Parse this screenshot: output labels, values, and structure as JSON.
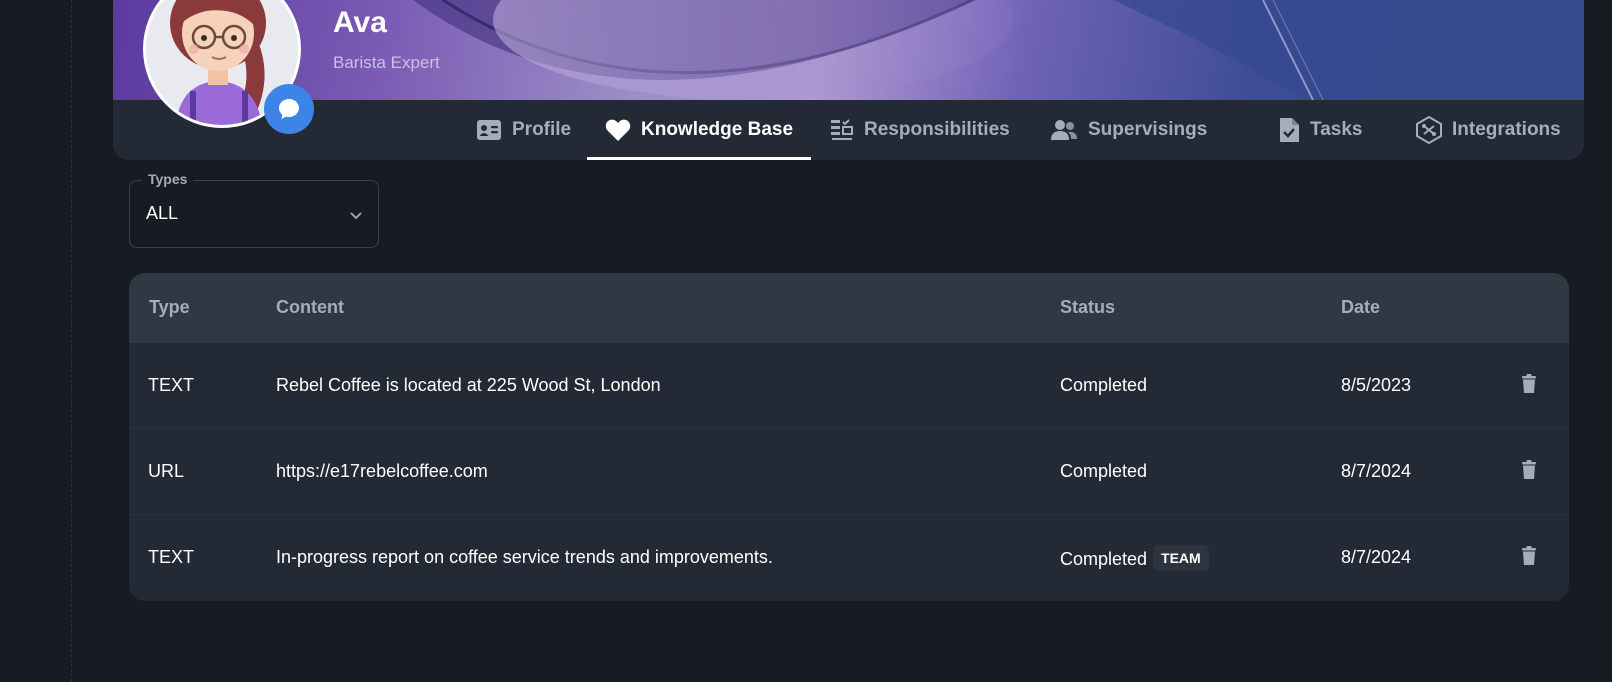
{
  "profile": {
    "name": "Ava",
    "role": "Barista Expert"
  },
  "tabs": [
    {
      "label": "Profile",
      "icon": "id-card-icon",
      "active": false
    },
    {
      "label": "Knowledge Base",
      "icon": "heart-icon",
      "active": true
    },
    {
      "label": "Responsibilities",
      "icon": "responsibilities-icon",
      "active": false
    },
    {
      "label": "Supervisings",
      "icon": "users-icon",
      "active": false
    },
    {
      "label": "Tasks",
      "icon": "file-check-icon",
      "active": false
    },
    {
      "label": "Integrations",
      "icon": "integrations-icon",
      "active": false
    }
  ],
  "filter": {
    "legend": "Types",
    "value": "ALL"
  },
  "table": {
    "headers": {
      "type": "Type",
      "content": "Content",
      "status": "Status",
      "date": "Date"
    },
    "rows": [
      {
        "type": "TEXT",
        "content": "Rebel Coffee is located at 225 Wood St, London",
        "status": "Completed",
        "badge": "",
        "date": "8/5/2023"
      },
      {
        "type": "URL",
        "content": "https://e17rebelcoffee.com",
        "status": "Completed",
        "badge": "",
        "date": "8/7/2024"
      },
      {
        "type": "TEXT",
        "content": "In-progress report on coffee service trends and improvements.",
        "status": "Completed",
        "badge": "TEAM",
        "date": "8/7/2024"
      }
    ]
  },
  "colors": {
    "background": "#171b22",
    "card": "#232a35",
    "header": "#303844",
    "accent": "#3d84e8",
    "muted": "#a6adb8"
  }
}
